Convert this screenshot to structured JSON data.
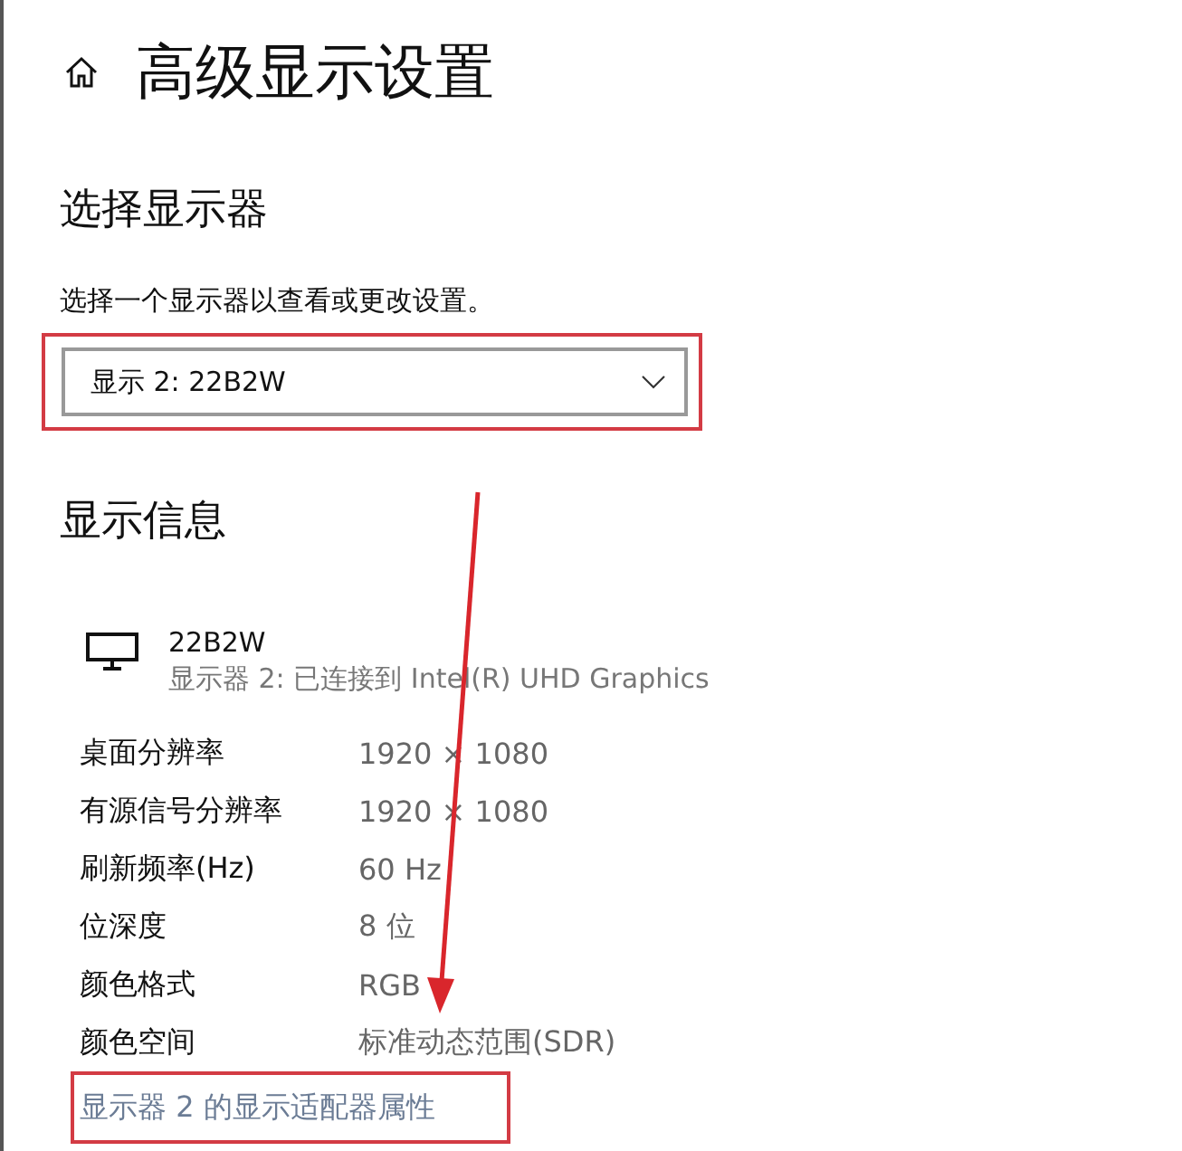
{
  "page": {
    "title": "高级显示设置"
  },
  "select_display": {
    "heading": "选择显示器",
    "description": "选择一个显示器以查看或更改设置。",
    "value": "显示 2: 22B2W",
    "highlighted": true
  },
  "display_info": {
    "heading": "显示信息",
    "monitor_name": "22B2W",
    "monitor_detail": "显示器 2: 已连接到 Intel(R) UHD Graphics",
    "rows": [
      {
        "label": "桌面分辨率",
        "value": "1920 × 1080"
      },
      {
        "label": "有源信号分辨率",
        "value": "1920 × 1080"
      },
      {
        "label": "刷新频率(Hz)",
        "value": "60 Hz"
      },
      {
        "label": "位深度",
        "value": "8 位"
      },
      {
        "label": "颜色格式",
        "value": "RGB"
      },
      {
        "label": "颜色空间",
        "value": "标准动态范围(SDR)"
      }
    ],
    "adapter_link": {
      "text": "显示器 2 的显示适配器属性",
      "highlighted": true
    }
  },
  "annotation_arrow": true
}
